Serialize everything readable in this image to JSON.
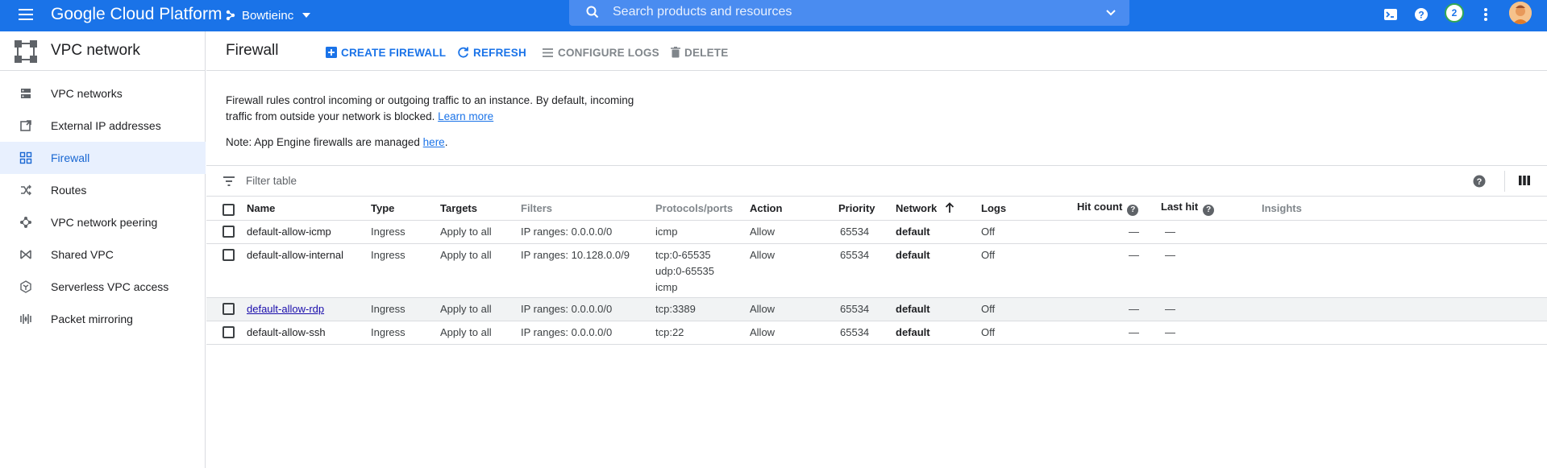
{
  "topbar": {
    "brand": "Google Cloud Platform",
    "project": "Bowtieinc",
    "search_placeholder": "Search products and resources",
    "notification_count": "2"
  },
  "sidebar": {
    "title": "VPC network",
    "items": [
      {
        "label": "VPC networks",
        "icon": "vpc-networks-icon"
      },
      {
        "label": "External IP addresses",
        "icon": "external-ip-icon"
      },
      {
        "label": "Firewall",
        "icon": "firewall-icon",
        "active": true
      },
      {
        "label": "Routes",
        "icon": "routes-icon"
      },
      {
        "label": "VPC network peering",
        "icon": "peering-icon"
      },
      {
        "label": "Shared VPC",
        "icon": "shared-vpc-icon"
      },
      {
        "label": "Serverless VPC access",
        "icon": "serverless-icon"
      },
      {
        "label": "Packet mirroring",
        "icon": "packet-mirroring-icon"
      }
    ]
  },
  "actionbar": {
    "title": "Firewall",
    "create": "CREATE FIREWALL",
    "refresh": "REFRESH",
    "configure_logs": "CONFIGURE LOGS",
    "delete": "DELETE"
  },
  "info": {
    "text": "Firewall rules control incoming or outgoing traffic to an instance. By default, incoming traffic from outside your network is blocked.",
    "learn_more": "Learn more",
    "note_prefix": "Note: App Engine firewalls are managed",
    "note_link": "here",
    "note_suffix": "."
  },
  "filter": {
    "placeholder": "Filter table"
  },
  "table": {
    "headers": {
      "name": "Name",
      "type": "Type",
      "targets": "Targets",
      "filters": "Filters",
      "protocols": "Protocols/ports",
      "action": "Action",
      "priority": "Priority",
      "network": "Network",
      "logs": "Logs",
      "hit_count": "Hit count",
      "last_hit": "Last hit",
      "insights": "Insights"
    },
    "rows": [
      {
        "name": "default-allow-icmp",
        "type": "Ingress",
        "targets": "Apply to all",
        "filters": "IP ranges: 0.0.0.0/0",
        "protocols": [
          "icmp"
        ],
        "action": "Allow",
        "priority": "65534",
        "network": "default",
        "logs": "Off",
        "hit_count": "—",
        "last_hit": "—"
      },
      {
        "name": "default-allow-internal",
        "type": "Ingress",
        "targets": "Apply to all",
        "filters": "IP ranges: 10.128.0.0/9",
        "protocols": [
          "tcp:0-65535",
          "udp:0-65535",
          "icmp"
        ],
        "action": "Allow",
        "priority": "65534",
        "network": "default",
        "logs": "Off",
        "hit_count": "—",
        "last_hit": "—"
      },
      {
        "name": "default-allow-rdp",
        "type": "Ingress",
        "targets": "Apply to all",
        "filters": "IP ranges: 0.0.0.0/0",
        "protocols": [
          "tcp:3389"
        ],
        "action": "Allow",
        "priority": "65534",
        "network": "default",
        "logs": "Off",
        "hit_count": "—",
        "last_hit": "—"
      },
      {
        "name": "default-allow-ssh",
        "type": "Ingress",
        "targets": "Apply to all",
        "filters": "IP ranges: 0.0.0.0/0",
        "protocols": [
          "tcp:22"
        ],
        "action": "Allow",
        "priority": "65534",
        "network": "default",
        "logs": "Off",
        "hit_count": "—",
        "last_hit": "—"
      }
    ]
  },
  "colors": {
    "brand_blue": "#1a73e8",
    "active_bg": "#e8f0fe",
    "hover_row": "#f1f3f4"
  }
}
